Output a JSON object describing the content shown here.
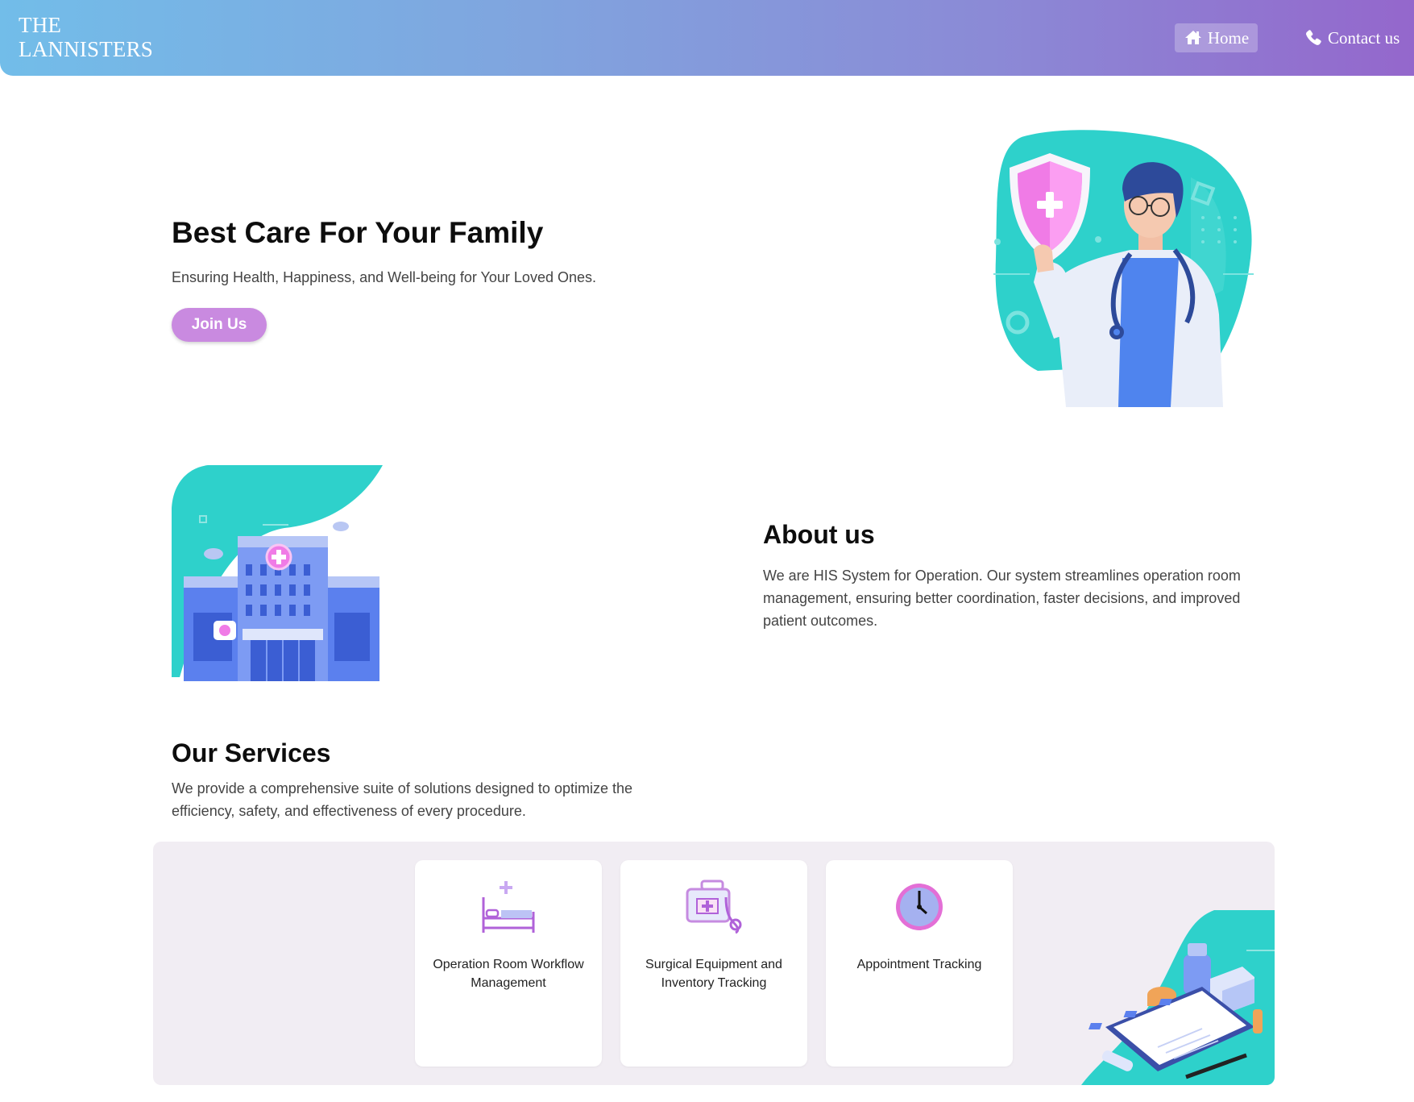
{
  "header": {
    "logo_line1": "THE",
    "logo_line2": "LANNISTERS",
    "nav": {
      "home_label": "Home",
      "home_icon": "home-icon",
      "contact_label": "Contact us",
      "contact_icon": "phone-icon"
    },
    "gradient_colors": [
      "#72bde9",
      "#9467cc"
    ]
  },
  "hero": {
    "title": "Best Care For Your Family",
    "subtitle": "Ensuring Health, Happiness, and Well-being for Your Loved Ones.",
    "cta_label": "Join Us",
    "cta_color": "#c98ae0",
    "illustration": "doctor-with-shield-illustration"
  },
  "about": {
    "title": "About us",
    "text": "We are HIS System for Operation. Our system streamlines operation room management, ensuring better coordination, faster decisions, and improved patient outcomes.",
    "illustration": "hospital-building-illustration"
  },
  "services": {
    "title": "Our Services",
    "text": "We provide a comprehensive suite of solutions designed to optimize the efficiency, safety, and effectiveness of every procedure.",
    "panel_color": "#f1edf3",
    "accent_color": "#2ed1cb",
    "items": [
      {
        "label": "Operation Room Workflow Management",
        "icon": "hospital-bed-icon"
      },
      {
        "label": "Surgical Equipment and Inventory Tracking",
        "icon": "medical-kit-icon"
      },
      {
        "label": "Appointment Tracking",
        "icon": "clock-icon"
      }
    ],
    "illustration": "clipboard-medicine-illustration"
  }
}
